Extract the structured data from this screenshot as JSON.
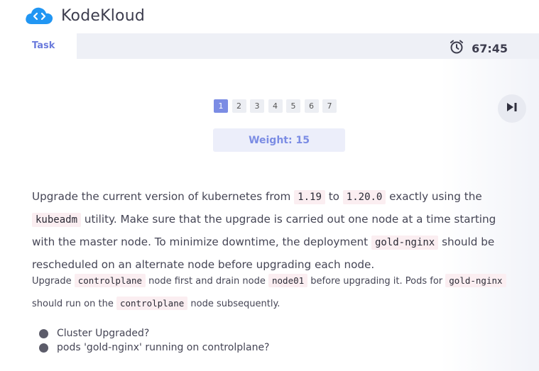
{
  "brand": {
    "name": "KodeKloud"
  },
  "header": {
    "task_label": "Task",
    "timer": "67:45"
  },
  "pager": {
    "pages": [
      "1",
      "2",
      "3",
      "4",
      "5",
      "6",
      "7"
    ],
    "active_page": "1"
  },
  "weight_label": "Weight: 15",
  "description": {
    "p1": {
      "t1": "Upgrade the current version of kubernetes from ",
      "c1": "1.19",
      "t2": " to ",
      "c2": "1.20.0",
      "t3": " exactly using the ",
      "c3": "kubeadm",
      "t4": " utility. Make sure that the upgrade is carried out one node at a time starting with the master node. To minimize downtime, the deployment ",
      "c4": "gold-nginx",
      "t5": " should be rescheduled on an alternate node before upgrading each node."
    },
    "p2": {
      "t1": "Upgrade ",
      "c1": "controlplane",
      "t2": " node first and drain node ",
      "c2": "node01",
      "t3": " before upgrading it. Pods for ",
      "c3": "gold-nginx",
      "t4": " should run on the ",
      "c4": "controlplane",
      "t5": " node subsequently."
    }
  },
  "checks": [
    "Cluster Upgraded?",
    "pods 'gold-nginx' running on controlplane?"
  ],
  "icons": {
    "logo": "kodekloud-cloud-logo",
    "timer": "alarm-clock-icon",
    "next": "skip-next-icon",
    "check": "bullet-dot-icon"
  },
  "colors": {
    "accent": "#7b8ce4",
    "code_bg": "#fbeef1",
    "header_bg": "#eef0f6",
    "logo_blue": "#2196f3"
  }
}
